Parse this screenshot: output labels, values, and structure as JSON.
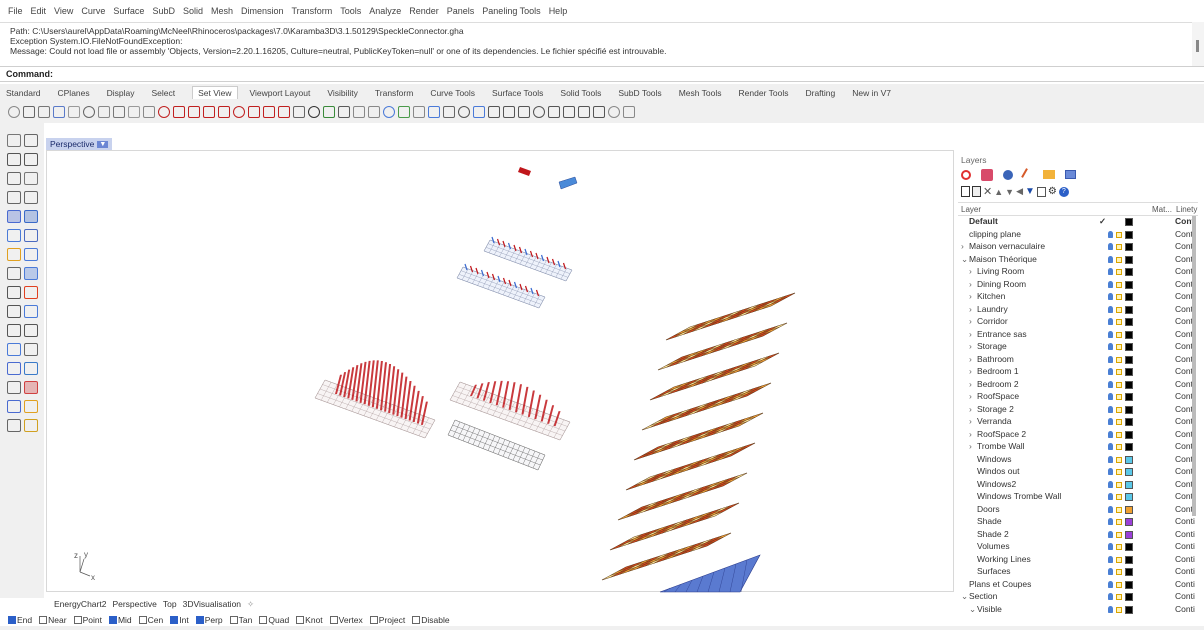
{
  "menu": [
    "File",
    "Edit",
    "View",
    "Curve",
    "Surface",
    "SubD",
    "Solid",
    "Mesh",
    "Dimension",
    "Transform",
    "Tools",
    "Analyze",
    "Render",
    "Panels",
    "Paneling Tools",
    "Help"
  ],
  "history": {
    "line1": "Path: C:\\Users\\aurel\\AppData\\Roaming\\McNeel\\Rhinoceros\\packages\\7.0\\Karamba3D\\3.1.50129\\SpeckleConnector.gha",
    "line2": "Exception System.IO.FileNotFoundException:",
    "line3": "Message: Could not load file or assembly 'Objects, Version=2.20.1.16205, Culture=neutral, PublicKeyToken=null' or one of its dependencies. Le fichier spécifié est introuvable."
  },
  "command_label": "Command:",
  "tabs": [
    "Standard",
    "CPlanes",
    "Display",
    "Select",
    "Set View",
    "Viewport Layout",
    "Visibility",
    "Transform",
    "Curve Tools",
    "Surface Tools",
    "Solid Tools",
    "SubD Tools",
    "Mesh Tools",
    "Render Tools",
    "Drafting",
    "New in V7"
  ],
  "active_tab": "Set View",
  "viewport": {
    "title": "Perspective",
    "tabs": [
      "EnergyChart2",
      "Perspective",
      "Top",
      "3DVisualisation"
    ],
    "axis_x": "x",
    "axis_y": "y",
    "axis_z": "z"
  },
  "osnaps": [
    {
      "label": "End",
      "on": true
    },
    {
      "label": "Near",
      "on": false
    },
    {
      "label": "Point",
      "on": false
    },
    {
      "label": "Mid",
      "on": true
    },
    {
      "label": "Cen",
      "on": false
    },
    {
      "label": "Int",
      "on": true
    },
    {
      "label": "Perp",
      "on": true
    },
    {
      "label": "Tan",
      "on": false
    },
    {
      "label": "Quad",
      "on": false
    },
    {
      "label": "Knot",
      "on": false
    },
    {
      "label": "Vertex",
      "on": false
    },
    {
      "label": "Project",
      "on": false
    },
    {
      "label": "Disable",
      "on": false
    }
  ],
  "layers_panel": {
    "title": "Layers",
    "header_layer": "Layer",
    "header_mat": "Mat...",
    "header_linetype": "Linety",
    "rows": [
      {
        "name": "Default",
        "indent": 0,
        "expand": "",
        "bold": true,
        "color": "#000000",
        "check": true,
        "lt": "Cont"
      },
      {
        "name": "clipping plane",
        "indent": 0,
        "expand": "",
        "color": "#000000",
        "lt": "Conti"
      },
      {
        "name": "Maison vernaculaire",
        "indent": 0,
        "expand": ">",
        "color": "#000000",
        "lt": "Conti"
      },
      {
        "name": "Maison Théorique",
        "indent": 0,
        "expand": "v",
        "color": "#000000",
        "lt": "Conti"
      },
      {
        "name": "Living Room",
        "indent": 1,
        "expand": ">",
        "color": "#000000",
        "lt": "Conti"
      },
      {
        "name": "Dining Room",
        "indent": 1,
        "expand": ">",
        "color": "#000000",
        "lt": "Conti"
      },
      {
        "name": "Kitchen",
        "indent": 1,
        "expand": ">",
        "color": "#000000",
        "lt": "Conti"
      },
      {
        "name": "Laundry",
        "indent": 1,
        "expand": ">",
        "color": "#000000",
        "lt": "Conti"
      },
      {
        "name": "Corridor",
        "indent": 1,
        "expand": ">",
        "color": "#000000",
        "lt": "Conti"
      },
      {
        "name": "Entrance sas",
        "indent": 1,
        "expand": ">",
        "color": "#000000",
        "lt": "Conti"
      },
      {
        "name": "Storage",
        "indent": 1,
        "expand": ">",
        "color": "#000000",
        "lt": "Conti"
      },
      {
        "name": "Bathroom",
        "indent": 1,
        "expand": ">",
        "color": "#000000",
        "lt": "Conti"
      },
      {
        "name": "Bedroom 1",
        "indent": 1,
        "expand": ">",
        "color": "#000000",
        "lt": "Conti"
      },
      {
        "name": "Bedroom 2",
        "indent": 1,
        "expand": ">",
        "color": "#000000",
        "lt": "Conti"
      },
      {
        "name": "RoofSpace",
        "indent": 1,
        "expand": ">",
        "color": "#000000",
        "lt": "Conti"
      },
      {
        "name": "Storage 2",
        "indent": 1,
        "expand": ">",
        "color": "#000000",
        "lt": "Conti"
      },
      {
        "name": "Verranda",
        "indent": 1,
        "expand": ">",
        "color": "#000000",
        "lt": "Conti"
      },
      {
        "name": "RoofSpace 2",
        "indent": 1,
        "expand": ">",
        "color": "#000000",
        "lt": "Conti"
      },
      {
        "name": "Trombe Wall",
        "indent": 1,
        "expand": ">",
        "color": "#000000",
        "lt": "Conti"
      },
      {
        "name": "Windows",
        "indent": 1,
        "expand": "",
        "color": "#5bc8e8",
        "lt": "Conti"
      },
      {
        "name": "Windos out",
        "indent": 1,
        "expand": "",
        "color": "#5bc8e8",
        "lt": "Conti"
      },
      {
        "name": "Windows2",
        "indent": 1,
        "expand": "",
        "color": "#5bc8e8",
        "lt": "Conti"
      },
      {
        "name": "Windows Trombe Wall",
        "indent": 1,
        "expand": "",
        "color": "#5bc8e8",
        "lt": "Conti"
      },
      {
        "name": "Doors",
        "indent": 1,
        "expand": "",
        "color": "#f0a030",
        "lt": "Conti"
      },
      {
        "name": "Shade",
        "indent": 1,
        "expand": "",
        "color": "#9b40d8",
        "lt": "Conti"
      },
      {
        "name": "Shade 2",
        "indent": 1,
        "expand": "",
        "color": "#9b40d8",
        "lt": "Conti"
      },
      {
        "name": "Volumes",
        "indent": 1,
        "expand": "",
        "color": "#000000",
        "lt": "Conti"
      },
      {
        "name": "Working Lines",
        "indent": 1,
        "expand": "",
        "color": "#000000",
        "lt": "Conti"
      },
      {
        "name": "Surfaces",
        "indent": 1,
        "expand": "",
        "color": "#000000",
        "lt": "Conti"
      },
      {
        "name": "Plans et Coupes",
        "indent": 0,
        "expand": "",
        "color": "#000000",
        "lt": "Conti"
      },
      {
        "name": "Section",
        "indent": 0,
        "expand": "v",
        "color": "#000000",
        "lt": "Conti"
      },
      {
        "name": "Visible",
        "indent": 1,
        "expand": "v",
        "color": "#000000",
        "lt": "Conti"
      }
    ]
  },
  "colors": {
    "accent": "#2b5fc8",
    "heat_hot": "#d9461e",
    "heat_warm": "#f2a23a",
    "heat_cool": "#ffe89a",
    "bar_red": "#c0161b"
  }
}
